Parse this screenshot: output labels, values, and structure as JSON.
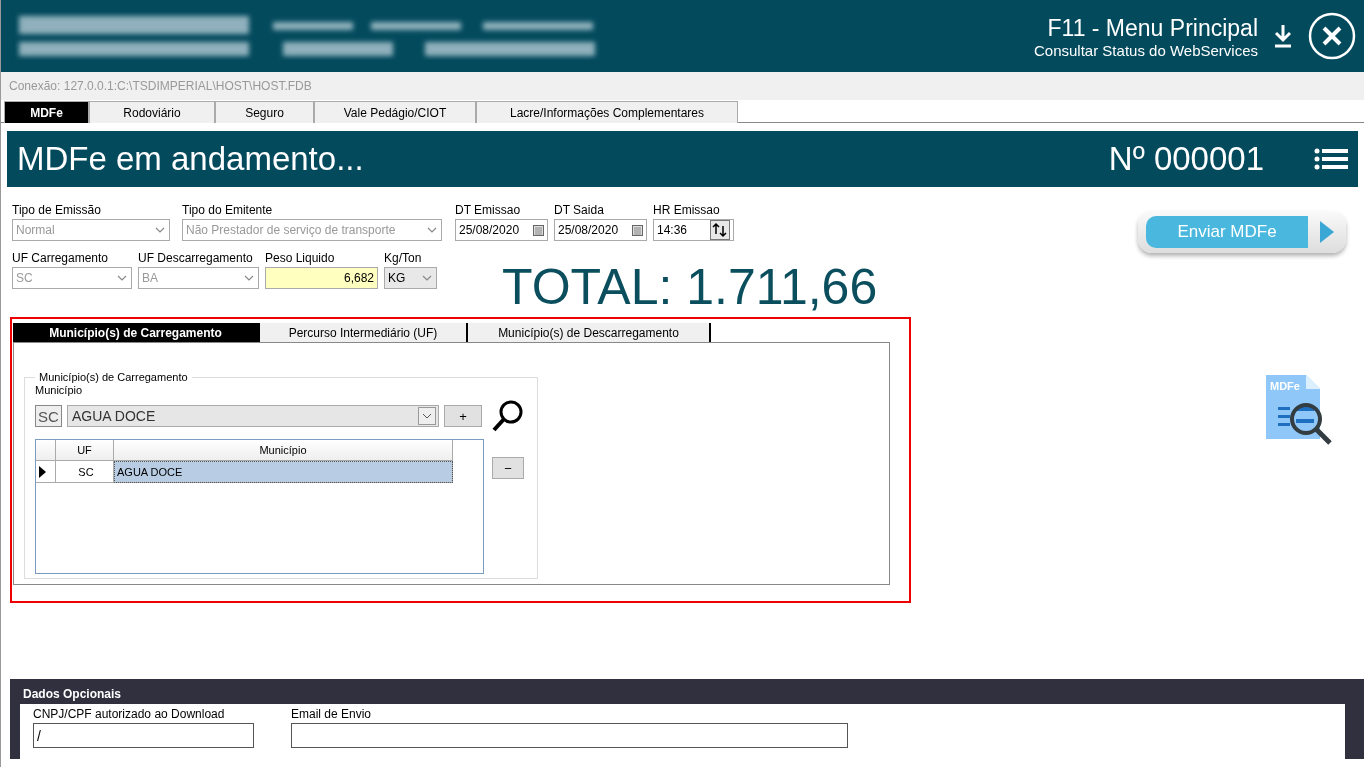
{
  "header": {
    "title": "F11 - Menu Principal",
    "subtitle": "Consultar Status do WebServices"
  },
  "connection": "Conexão: 127.0.0.1:C:\\TSDIMPERIAL\\HOST\\HOST.FDB",
  "tabs": [
    {
      "label": "MDFe",
      "selected": true
    },
    {
      "label": "Rodoviário",
      "selected": false
    },
    {
      "label": "Seguro",
      "selected": false
    },
    {
      "label": "Vale Pedágio/CIOT",
      "selected": false
    },
    {
      "label": "Lacre/Informações Complementares",
      "selected": false
    }
  ],
  "banner": {
    "title": "MDFe em andamento...",
    "number": "Nº 000001"
  },
  "form_rows": [
    [
      {
        "kind": "combo",
        "label": "Tipo de Emissão",
        "value": "Normal",
        "disabled": true
      },
      {
        "kind": "combo",
        "label": "Tipo do Emitente",
        "value": "Não Prestador de serviço de transporte",
        "disabled": true
      },
      {
        "kind": "date",
        "label": "DT Emissao",
        "value": "25/08/2020"
      },
      {
        "kind": "date",
        "label": "DT Saida",
        "value": "25/08/2020"
      },
      {
        "kind": "time",
        "label": "HR Emissao",
        "value": "14:36"
      }
    ],
    [
      {
        "kind": "combo",
        "label": "UF Carregamento",
        "value": "SC",
        "disabled": true
      },
      {
        "kind": "combo",
        "label": "UF Descarregamento",
        "value": "BA",
        "disabled": true
      },
      {
        "kind": "number",
        "label": "Peso Liquido",
        "value": "6,682"
      },
      {
        "kind": "combo",
        "label": "Kg/Ton",
        "value": "KG",
        "disabled": false
      }
    ]
  ],
  "total": "TOTAL: 1.711,66",
  "send_button": "Enviar MDFe",
  "sub_tabs": [
    {
      "label": "Município(s) de Carregamento",
      "selected": true
    },
    {
      "label": "Percurso Intermediário (UF)",
      "selected": false
    },
    {
      "label": "Município(s) de Descarregamento",
      "selected": false
    }
  ],
  "municipios": {
    "group_title": "Município(s) de Carregamento",
    "field_label": "Município",
    "uf": "SC",
    "value": "AGUA DOCE",
    "add_button": "+",
    "remove_button": "−",
    "columns": [
      "UF",
      "Município"
    ],
    "rows": [
      {
        "uf": "SC",
        "municipio": "AGUA DOCE",
        "selected": true
      }
    ]
  },
  "doc_icon_label": "MDFe",
  "dados_opcionais": {
    "title": "Dados Opcionais",
    "fields": [
      {
        "label": "CNPJ/CPF autorizado ao Download",
        "value": "/"
      },
      {
        "label": "Email de Envio"
      }
    ]
  }
}
